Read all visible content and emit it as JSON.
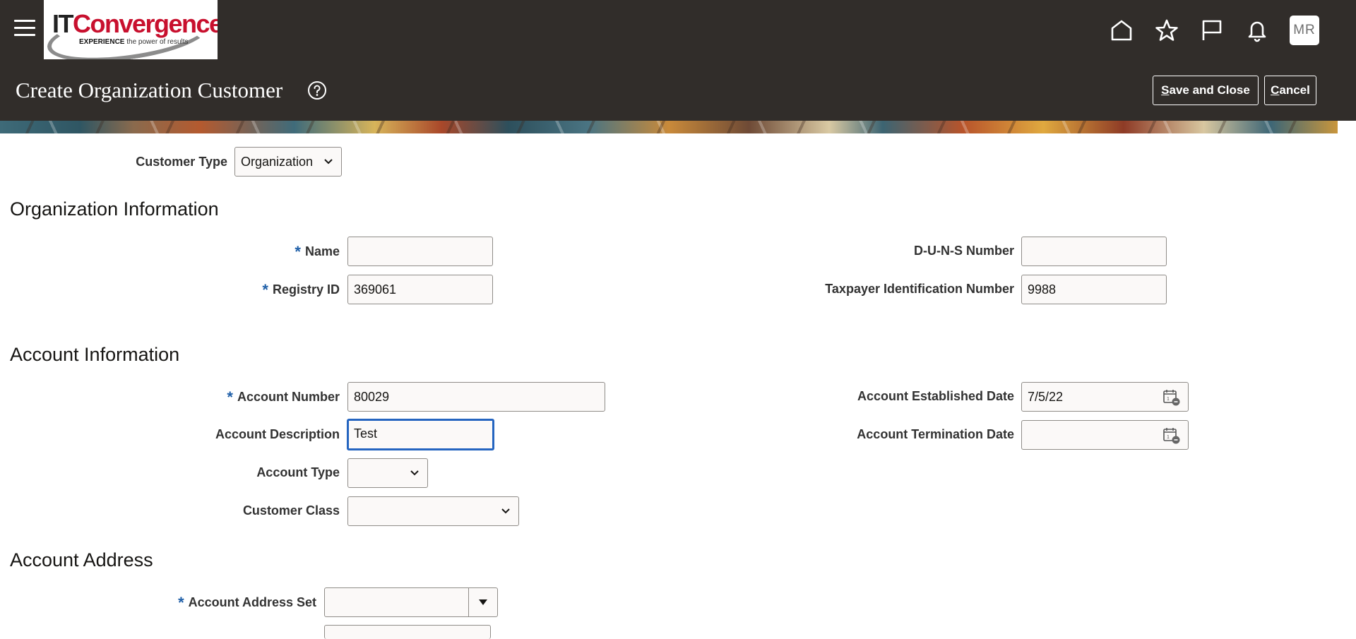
{
  "header": {
    "user_initials": "MR",
    "page_title": "Create Organization Customer",
    "save_close_first": "S",
    "save_close_rest": "ave and Close",
    "cancel_first": "C",
    "cancel_rest": "ancel"
  },
  "logo": {
    "brand_it": "IT",
    "brand_rest": "Convergence",
    "tag_bold": "EXPERIENCE",
    "tag_rest": " the power of results"
  },
  "icons": {
    "menu": "hamburger-menu-icon",
    "home": "home-icon",
    "favorites": "star-icon",
    "watchlist": "flag-icon",
    "notifications": "bell-icon",
    "help": "help-icon",
    "calendar": "calendar-icon"
  },
  "form": {
    "customer_type": {
      "label": "Customer Type",
      "value": "Organization"
    },
    "sections": {
      "org_info": "Organization Information",
      "account_info": "Account Information",
      "account_address": "Account Address"
    },
    "name": {
      "label": "Name",
      "value": ""
    },
    "registry_id": {
      "label": "Registry ID",
      "value": "369061"
    },
    "duns": {
      "label": "D-U-N-S Number",
      "value": ""
    },
    "taxpayer_id": {
      "label": "Taxpayer Identification Number",
      "value": "9988"
    },
    "account_number": {
      "label": "Account Number",
      "value": "80029"
    },
    "account_description": {
      "label": "Account Description",
      "value": "Test"
    },
    "account_type": {
      "label": "Account Type",
      "value": ""
    },
    "customer_class": {
      "label": "Customer Class",
      "value": ""
    },
    "account_established_date": {
      "label": "Account Established Date",
      "value": "7/5/22"
    },
    "account_termination_date": {
      "label": "Account Termination Date",
      "value": ""
    },
    "account_address_set": {
      "label": "Account Address Set",
      "value": ""
    },
    "required_marker": "*"
  },
  "colors": {
    "header_bg": "#312d2a",
    "focus_border": "#2565c0",
    "required": "#1f5fa8"
  }
}
